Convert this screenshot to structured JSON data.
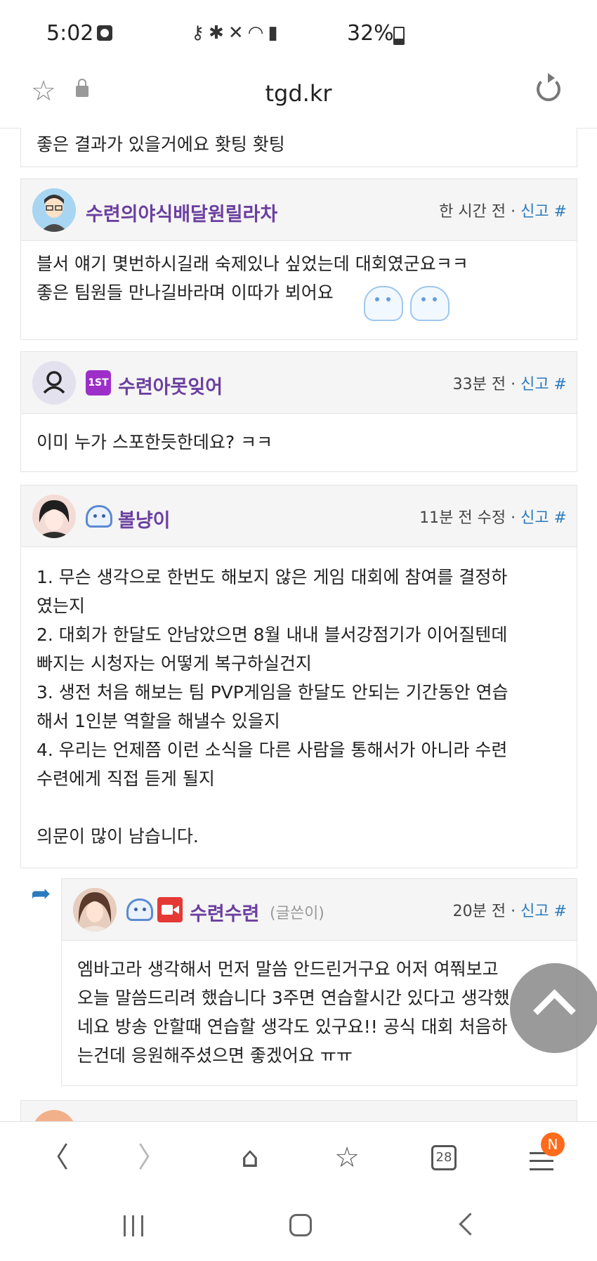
{
  "status_bar": {
    "time": "5:02",
    "battery_percent": "32%",
    "battery_level": 0.32,
    "icons": [
      "alarm-icon",
      "key-icon",
      "bluetooth-icon",
      "mute-icon",
      "wifi-icon",
      "volte-icon",
      "signal-icon",
      "battery-icon"
    ]
  },
  "browser": {
    "url": "tgd.kr",
    "icons": [
      "star-icon",
      "lock-icon",
      "reload-icon"
    ]
  },
  "comments": [
    {
      "id": "c0",
      "body": "좋은 결과가 있을거에요 홧팅 홧팅"
    },
    {
      "id": "c1",
      "nickname": "수련의야식배달원릴라차",
      "time": "한 시간 전",
      "report": "신고 #",
      "body": "블서 얘기 몇번하시길래 숙제있나 싶었는데 대회였군요ㅋㅋ\n좋은 팀원들 만나길바라며 이따가 뵈어요"
    },
    {
      "id": "c2",
      "nickname": "수련아못잊어",
      "badge": "1ST",
      "time": "33분 전",
      "report": "신고 #",
      "body": "이미 누가 스포한듯한데요? ㅋㅋ"
    },
    {
      "id": "c3",
      "nickname": "볼냥이",
      "time": "11분 전 수정",
      "report": "신고 #",
      "body": "1. 무슨 생각으로 한번도 해보지 않은 게임 대회에 참여를 결정하\n였는지\n2. 대회가 한달도 안남았으면 8월 내내 블서강점기가 이어질텐데\n빠지는 시청자는 어떻게 복구하실건지\n3. 생전 처음 해보는 팀 PVP게임을 한달도 안되는 기간동안 연습\n해서 1인분 역할을 해낼수 있을지\n4. 우리는 언제쯤 이런 소식을 다른 사람을 통해서가 아니라 수련\n수련에게 직접 듣게 될지\n\n의문이 많이 남습니다."
    },
    {
      "id": "c4",
      "nickname": "수련수련",
      "author_tag": "(글쓴이)",
      "time": "20분 전",
      "report": "신고 #",
      "body": "엠바고라 생각해서 먼저 말씀 안드린거구요 어저 여쭤보고\n오늘 말씀드리려 했습니다 3주면 연습할시간 있다고 생각했\n네요 방송 안할때 연습할 생각도 있구요!! 공식 대회  처음하\n는건데 응원해주셨으면 좋겠어요 ㅠㅠ"
    }
  ],
  "bottom_nav": {
    "tab_count": "28",
    "menu_badge": "N",
    "items": [
      "back-icon",
      "forward-icon",
      "home-icon",
      "bookmarks-icon",
      "tabs-icon",
      "menu-icon"
    ]
  }
}
